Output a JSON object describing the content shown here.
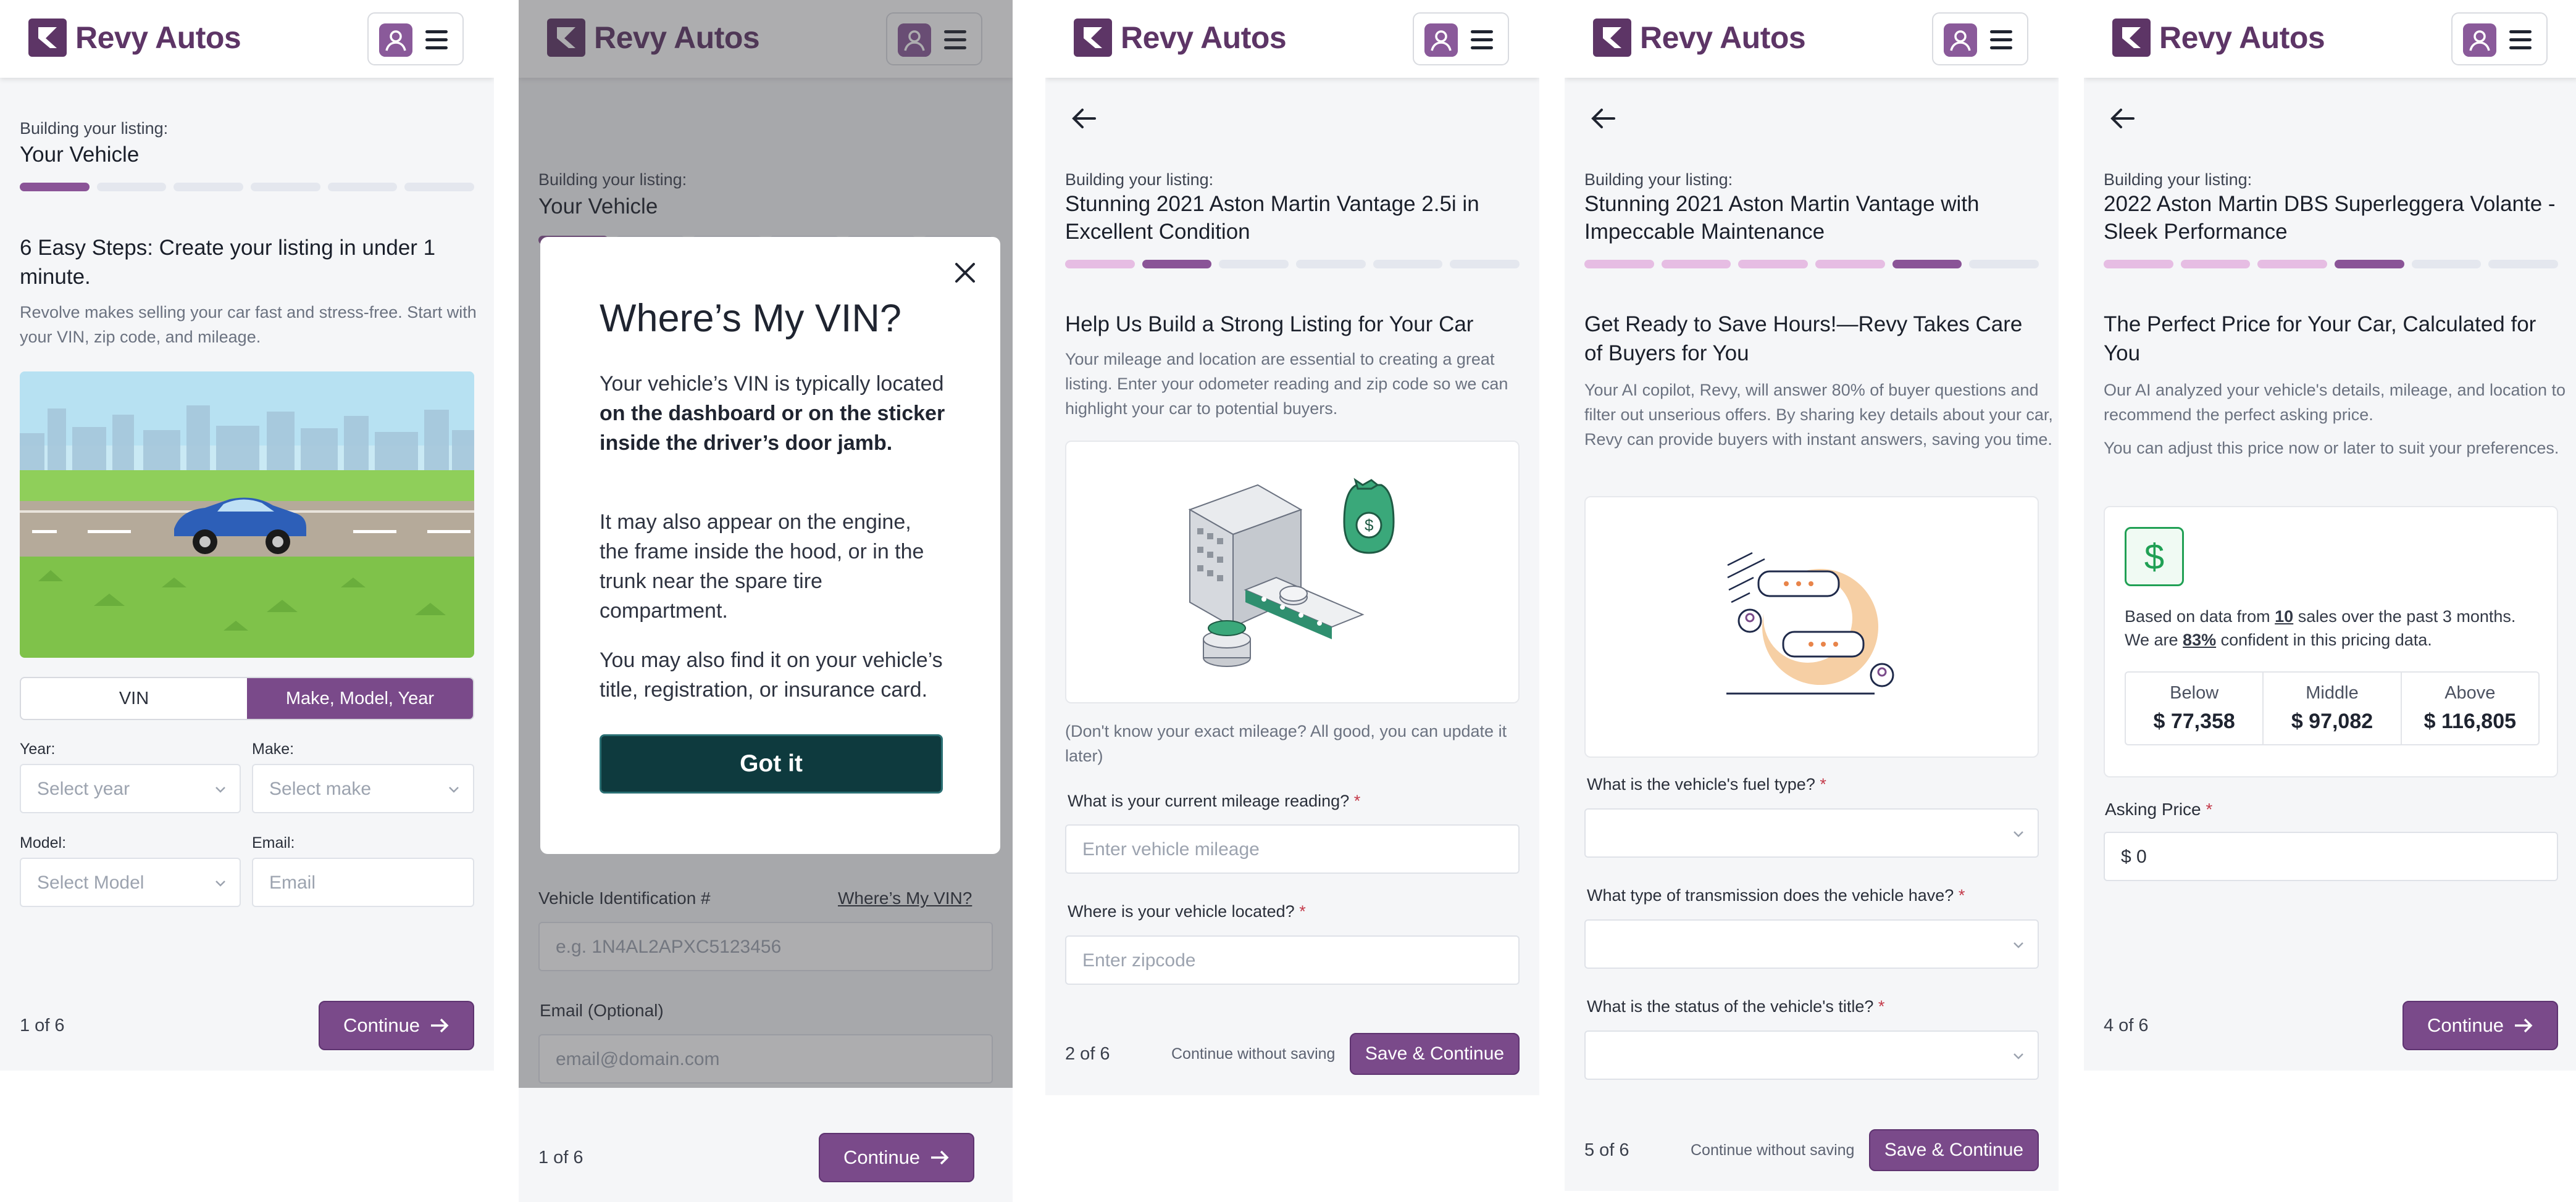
{
  "brand": {
    "name": "Revy Autos"
  },
  "panel1": {
    "building_label": "Building your listing:",
    "section": "Your Vehicle",
    "heading": "6 Easy Steps: Create your listing in under 1 minute.",
    "description": "Revolve makes selling your car fast and stress-free. Start with your VIN, zip code, and mileage.",
    "progress": {
      "current_step": 1,
      "total_steps": 6
    },
    "toggle": {
      "options": [
        "VIN",
        "Make, Model, Year"
      ],
      "selected": "Make, Model, Year"
    },
    "fields": {
      "year": {
        "label": "Year:",
        "placeholder": "Select year"
      },
      "make": {
        "label": "Make:",
        "placeholder": "Select make"
      },
      "model": {
        "label": "Model:",
        "placeholder": "Select Model"
      },
      "email": {
        "label": "Email:",
        "placeholder": "Email"
      }
    },
    "step_count": "1 of 6",
    "continue": "Continue"
  },
  "panel2": {
    "building_label": "Building your listing:",
    "section": "Your Vehicle",
    "modal": {
      "title": "Where’s My VIN?",
      "p1_a": "Your vehicle’s VIN is typically located ",
      "p1_b": "on the dashboard or on the sticker inside the driver’s door jamb.",
      "p2": "It may also appear on the engine, the frame inside the hood, or in the trunk near the spare tire compartment.",
      "p3": "You may also find it on your vehicle’s title, registration, or insurance card.",
      "button": "Got it"
    },
    "vin_label": "Vehicle Identification #",
    "vin_link": "Where’s My VIN?",
    "vin_placeholder": "e.g. 1N4AL2APXC5123456",
    "email_label": "Email (Optional)",
    "email_placeholder": "email@domain.com",
    "step_count": "1 of 6",
    "continue": "Continue"
  },
  "panel3": {
    "building_label": "Building your listing:",
    "title": "Stunning 2021 Aston Martin Vantage 2.5i in Excellent Condition",
    "progress": {
      "current_step": 2,
      "total_steps": 6
    },
    "heading": "Help Us Build a Strong Listing for Your Car",
    "description": "Your mileage and location are essential to creating a great listing. Enter your odometer reading and zip code so we can highlight your car to potential buyers.",
    "note": "(Don't know your exact mileage? All good, you can update it later)",
    "mileage": {
      "label": "What is your current mileage reading?",
      "required": "*",
      "placeholder": "Enter vehicle mileage"
    },
    "location": {
      "label": "Where is your vehicle located?",
      "required": "*",
      "placeholder": "Enter zipcode"
    },
    "step_count": "2 of 6",
    "continue_without_saving": "Continue without saving",
    "save_continue": "Save & Continue"
  },
  "panel4": {
    "building_label": "Building your listing:",
    "title": "Stunning 2021 Aston Martin Vantage with Impeccable Maintenance",
    "progress": {
      "current_step": 5,
      "total_steps": 6
    },
    "heading": "Get Ready to Save Hours!—Revy Takes Care of Buyers for You",
    "description": "Your AI copilot, Revy, will answer 80% of buyer questions and filter out unserious offers. By sharing key details about your car, Revy can provide buyers with instant answers, saving you time.",
    "fuel": {
      "label": "What is the vehicle's fuel type?",
      "required": "*"
    },
    "transmission": {
      "label": "What type of transmission does the vehicle have?",
      "required": "*"
    },
    "title_status": {
      "label": "What is the status of the vehicle's title?",
      "required": "*"
    },
    "step_count": "5 of 6",
    "continue_without_saving": "Continue without saving",
    "save_continue": "Save & Continue"
  },
  "panel5": {
    "building_label": "Building your listing:",
    "title": "2022 Aston Martin DBS Superleggera Volante - Sleek Performance",
    "progress": {
      "current_step": 4,
      "total_steps": 6
    },
    "heading": "The Perfect Price for Your Car, Calculated for You",
    "description1": "Our AI analyzed your vehicle's details, mileage, and location to recommend the perfect asking price.",
    "description2": "You can adjust this price now or later to suit your preferences.",
    "pricing": {
      "dollar_icon": "$",
      "based_a": "Based on data from ",
      "sales_count": "10",
      "based_b": " sales over the past 3 months.",
      "conf_a": "We are ",
      "confidence": "83%",
      "conf_b": " confident in this pricing data.",
      "tiers": [
        {
          "label": "Below",
          "value": "$ 77,358"
        },
        {
          "label": "Middle",
          "value": "$ 97,082"
        },
        {
          "label": "Above",
          "value": "$ 116,805"
        }
      ]
    },
    "asking_price": {
      "label": "Asking Price",
      "required": "*",
      "value": "$ 0"
    },
    "step_count": "4 of 6",
    "continue": "Continue"
  },
  "icons": {
    "logo": "revy-logo-icon",
    "user": "user-icon",
    "menu": "hamburger-icon",
    "back": "arrow-left-icon",
    "close": "close-icon",
    "chevron": "chevron-down-icon",
    "continue_arrow": "arrow-right-icon"
  },
  "colors": {
    "brand_purple": "#7a4a8a",
    "progress_done": "#e6bde3",
    "progress_current": "#8a5497",
    "dark_teal": "#0e3a3e",
    "money_green": "#20a054"
  }
}
